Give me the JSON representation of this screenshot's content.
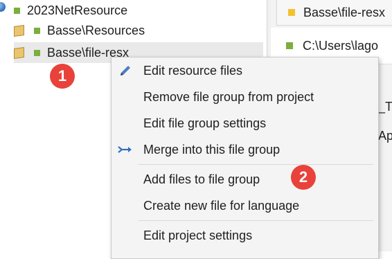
{
  "tree": {
    "root": "2023NetResource",
    "items": [
      {
        "label": "Basse\\Resources"
      },
      {
        "label": "Basse\\file-resx"
      }
    ]
  },
  "right_panel": {
    "tab_label": "Basse\\file-resx",
    "item_path": "C:\\Users\\lago",
    "fragment_1": "_T",
    "fragment_2": "Ap"
  },
  "context_menu": {
    "items": [
      {
        "label": "Edit resource files",
        "icon": "pencil-icon"
      },
      {
        "label": "Remove file group from project"
      },
      {
        "label": "Edit file group settings"
      },
      {
        "label": "Merge into this file group",
        "icon": "merge-arrow-icon"
      },
      {
        "label": "Add files to file group"
      },
      {
        "label": "Create new file for language"
      },
      {
        "label": "Edit project settings"
      }
    ]
  },
  "badges": {
    "step1": "1",
    "step2": "2"
  },
  "colors": {
    "badge": "#e8423a",
    "tree_square": "#7cae3e",
    "tab_square": "#f2c230",
    "menu_bg": "#f4f4f4"
  }
}
